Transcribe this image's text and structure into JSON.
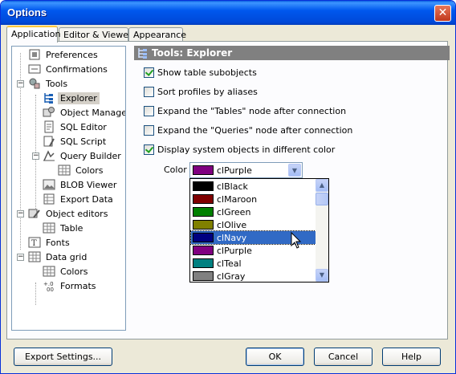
{
  "window": {
    "title": "Options"
  },
  "tabs": [
    {
      "label": "Application",
      "active": true
    },
    {
      "label": "Editor & Viewers",
      "active": false
    },
    {
      "label": "Appearance",
      "active": false
    }
  ],
  "tree": {
    "items": [
      {
        "label": "Preferences",
        "icon": "preferences-icon"
      },
      {
        "label": "Confirmations",
        "icon": "confirmations-icon"
      },
      {
        "label": "Tools",
        "icon": "tools-icon",
        "expanded": true
      },
      {
        "label": "Explorer",
        "icon": "explorer-icon",
        "selected": true
      },
      {
        "label": "Object Manager",
        "icon": "object-manager-icon"
      },
      {
        "label": "SQL Editor",
        "icon": "sql-editor-icon"
      },
      {
        "label": "SQL Script",
        "icon": "sql-script-icon"
      },
      {
        "label": "Query Builder",
        "icon": "query-builder-icon",
        "expanded": true
      },
      {
        "label": "Colors",
        "icon": "grid-icon"
      },
      {
        "label": "BLOB Viewer",
        "icon": "blob-viewer-icon"
      },
      {
        "label": "Export Data",
        "icon": "export-data-icon"
      },
      {
        "label": "Object editors",
        "icon": "object-editors-icon",
        "expanded": true
      },
      {
        "label": "Table",
        "icon": "grid-icon"
      },
      {
        "label": "Fonts",
        "icon": "fonts-icon"
      },
      {
        "label": "Data grid",
        "icon": "data-grid-icon",
        "expanded": true
      },
      {
        "label": "Colors",
        "icon": "grid-icon"
      },
      {
        "label": "Formats",
        "icon": "formats-icon"
      }
    ]
  },
  "panel": {
    "title": "Tools: Explorer",
    "options": [
      {
        "label": "Show table subobjects",
        "checked": true
      },
      {
        "label": "Sort profiles by aliases",
        "checked": false
      },
      {
        "label": "Expand the \"Tables\" node after connection",
        "checked": false
      },
      {
        "label": "Expand the \"Queries\" node after connection",
        "checked": false
      },
      {
        "label": "Display system objects in different color",
        "checked": true
      }
    ],
    "color_label": "Color",
    "color_selected": {
      "name": "clPurple",
      "hex": "#800080"
    },
    "color_list": [
      {
        "name": "clBlack",
        "hex": "#000000"
      },
      {
        "name": "clMaroon",
        "hex": "#800000"
      },
      {
        "name": "clGreen",
        "hex": "#008000"
      },
      {
        "name": "clOlive",
        "hex": "#808000"
      },
      {
        "name": "clNavy",
        "hex": "#000080",
        "highlighted": true
      },
      {
        "name": "clPurple",
        "hex": "#800080"
      },
      {
        "name": "clTeal",
        "hex": "#008080"
      },
      {
        "name": "clGray",
        "hex": "#808080"
      }
    ]
  },
  "buttons": {
    "export": "Export Settings...",
    "ok": "OK",
    "cancel": "Cancel",
    "help": "Help"
  }
}
